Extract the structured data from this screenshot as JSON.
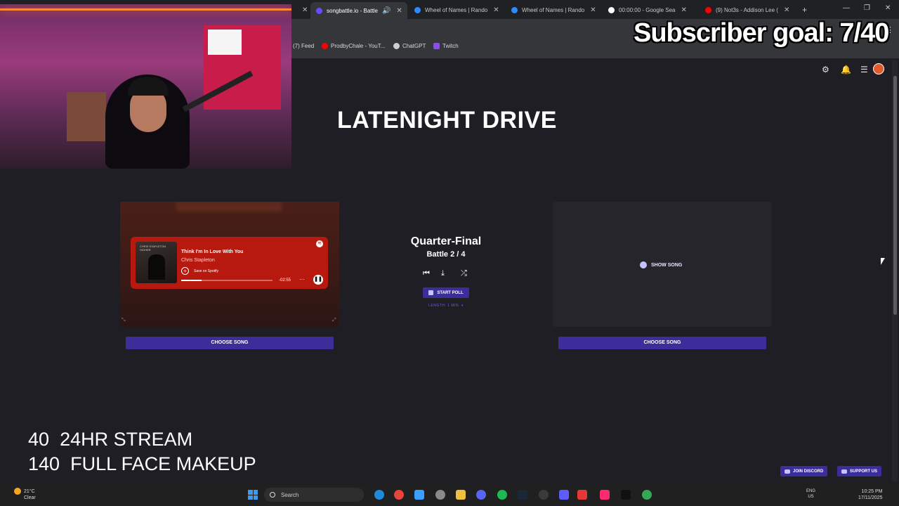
{
  "browser": {
    "tabs": [
      {
        "label": "songbattle.io - Battle",
        "active": true,
        "color": "#6a4cff"
      },
      {
        "label": "Wheel of Names | Rando",
        "active": false,
        "color": "#2b8cff"
      },
      {
        "label": "Wheel of Names | Rando",
        "active": false,
        "color": "#2b8cff"
      },
      {
        "label": "00:00:00 - Google Sea",
        "active": false,
        "color": "#ffffff"
      },
      {
        "label": "(9) Not3s - Addison Lee (",
        "active": false,
        "color": "#ff0000"
      }
    ],
    "new_tab": "+",
    "bookmarks": [
      {
        "label": "(7) Feed",
        "color": "#2a2a2a"
      },
      {
        "label": "ProdbyChale - YouT...",
        "color": "#ff0000"
      },
      {
        "label": "ChatGPT",
        "color": "#cfcfcf"
      },
      {
        "label": "Twitch",
        "color": "#9146ff"
      }
    ]
  },
  "overlay": {
    "subscriber_goal": "Subscriber goal: 7/40",
    "goals": [
      {
        "amount": "40",
        "label": "24HR STREAM"
      },
      {
        "amount": "140",
        "label": "FULL FACE MAKEUP"
      }
    ]
  },
  "page": {
    "title": "LATENIGHT DRIVE",
    "round": "Quarter-Final",
    "battle": "Battle 2 / 4",
    "start_poll": "START POLL",
    "length": "LENGTH: 1 MIN. ▾",
    "left": {
      "player": {
        "song_title": "Think I'm In Love With You",
        "artist": "Chris Stapleton",
        "save_label": "Save on Spotify",
        "time_remaining": "-02:55",
        "progress": 0.22,
        "more": "···",
        "pause": "❚❚",
        "album_text": "CHRIS STAPLETON HIGHER",
        "accent": "#b8190f"
      },
      "choose_label": "CHOOSE SONG"
    },
    "right": {
      "show_song": "SHOW SONG",
      "choose_label": "CHOOSE SONG"
    },
    "footer": {
      "discord": "JOIN DISCORD",
      "support": "SUPPORT US"
    }
  },
  "taskbar": {
    "weather_temp": "21°C",
    "weather_desc": "Clear",
    "search_placeholder": "Search",
    "lang": "ENG",
    "region": "US",
    "time": "10:25 PM",
    "date": "17/11/2025"
  }
}
